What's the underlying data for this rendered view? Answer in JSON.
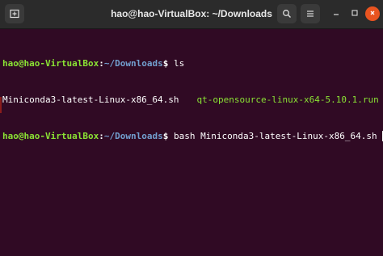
{
  "window": {
    "title": "hao@hao-VirtualBox: ~/Downloads"
  },
  "toolbar": {
    "new_tab_icon": "new-tab-icon",
    "search_icon": "search-icon",
    "menu_icon": "hamburger-menu-icon",
    "minimize_icon": "minimize-icon",
    "maximize_icon": "maximize-icon",
    "close_icon": "close-icon"
  },
  "terminal": {
    "lines": [
      {
        "user_host": "hao@hao-VirtualBox",
        "colon": ":",
        "path": "~/Downloads",
        "dollar": "$",
        "command": " ls"
      },
      {
        "files": [
          "Miniconda3-latest-Linux-x86_64.sh",
          "qt-opensource-linux-x64-5.10.1.run"
        ]
      },
      {
        "user_host": "hao@hao-VirtualBox",
        "colon": ":",
        "path": "~/Downloads",
        "dollar": "$",
        "command": " bash Miniconda3-latest-Linux-x86_64.sh"
      }
    ]
  },
  "colors": {
    "terminal_background": "#300a24",
    "prompt_user": "#8ae234",
    "prompt_path": "#729fcf",
    "executable_file": "#8ae234",
    "close_button": "#e95420"
  }
}
